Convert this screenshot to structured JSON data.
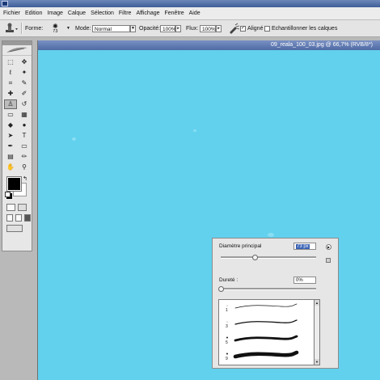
{
  "menu": [
    "Fichier",
    "Edition",
    "Image",
    "Calque",
    "Sélection",
    "Filtre",
    "Affichage",
    "Fenêtre",
    "Aide"
  ],
  "options": {
    "forme_label": "Forme:",
    "brush_size": "73",
    "mode_label": "Mode:",
    "mode_value": "Normal",
    "opacite_label": "Opacité:",
    "opacite_value": "100%",
    "flux_label": "Flux:",
    "flux_value": "100%",
    "aligne_label": "Aligné",
    "aligne_checked": true,
    "echantillonner_label": "Echantillonner les calques",
    "echantillonner_checked": false
  },
  "document": {
    "title": "09_reala_100_03.jpg @ 66,7% (RVB/8*)",
    "background_color": "#62d1ee"
  },
  "toolbox": {
    "tools": [
      {
        "icon": "marquee-icon",
        "glyph": "⬚"
      },
      {
        "icon": "move-icon",
        "glyph": "✥"
      },
      {
        "icon": "lasso-icon",
        "glyph": "ℓ"
      },
      {
        "icon": "magic-wand-icon",
        "glyph": "✦"
      },
      {
        "icon": "crop-icon",
        "glyph": "⌗"
      },
      {
        "icon": "slice-icon",
        "glyph": "✎"
      },
      {
        "icon": "healing-brush-icon",
        "glyph": "✚"
      },
      {
        "icon": "brush-icon",
        "glyph": "✐"
      },
      {
        "icon": "clone-stamp-icon",
        "glyph": "♙",
        "selected": true
      },
      {
        "icon": "history-brush-icon",
        "glyph": "↺"
      },
      {
        "icon": "eraser-icon",
        "glyph": "▭"
      },
      {
        "icon": "gradient-icon",
        "glyph": "▦"
      },
      {
        "icon": "blur-icon",
        "glyph": "◆"
      },
      {
        "icon": "dodge-icon",
        "glyph": "●"
      },
      {
        "icon": "path-select-icon",
        "glyph": "➤"
      },
      {
        "icon": "type-icon",
        "glyph": "T"
      },
      {
        "icon": "pen-icon",
        "glyph": "✒"
      },
      {
        "icon": "rectangle-icon",
        "glyph": "▭"
      },
      {
        "icon": "notes-icon",
        "glyph": "▤"
      },
      {
        "icon": "eyedropper-icon",
        "glyph": "✏"
      },
      {
        "icon": "hand-icon",
        "glyph": "✋"
      },
      {
        "icon": "zoom-icon",
        "glyph": "⚲"
      }
    ],
    "foreground_color": "#000000",
    "background_color": "#ffffff"
  },
  "brush_picker": {
    "diameter_label": "Diamètre principal",
    "diameter_value": "73 px",
    "diameter_fraction": 0.36,
    "hardness_label": "Dureté :",
    "hardness_value": "0%",
    "hardness_fraction": 0.0,
    "brushes": [
      {
        "dot": "·",
        "number": "1",
        "stroke_width": 0.7
      },
      {
        "dot": "·",
        "number": "3",
        "stroke_width": 1.3
      },
      {
        "dot": "•",
        "number": "5",
        "stroke_width": 2.8
      },
      {
        "dot": "•",
        "number": "9",
        "stroke_width": 4.6
      }
    ]
  }
}
